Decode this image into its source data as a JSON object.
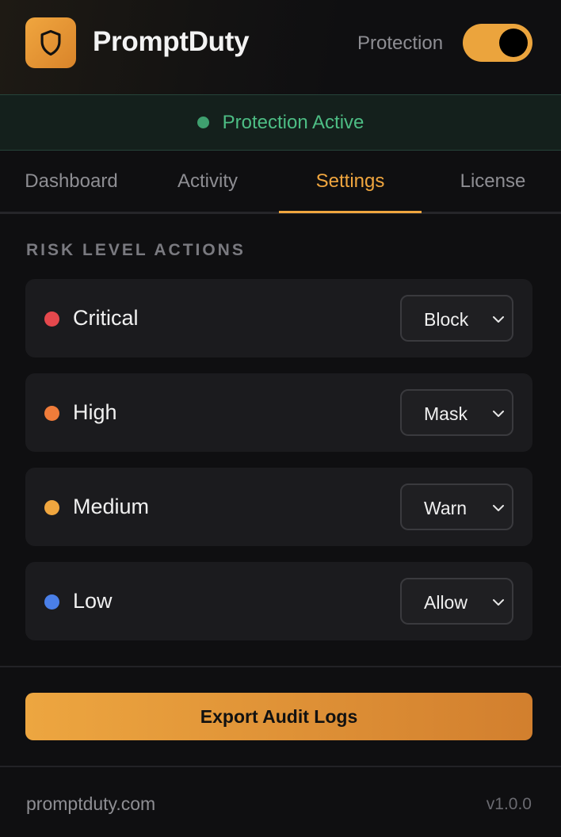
{
  "header": {
    "title": "PromptDuty",
    "logo_icon": "shield-icon",
    "protection_label": "Protection",
    "protection_enabled": true
  },
  "status": {
    "text": "Protection Active",
    "color": "#4dbd84"
  },
  "tabs": [
    {
      "label": "Dashboard",
      "active": false
    },
    {
      "label": "Activity",
      "active": false
    },
    {
      "label": "Settings",
      "active": true
    },
    {
      "label": "License",
      "active": false
    }
  ],
  "risk_section": {
    "title": "RISK LEVEL ACTIONS",
    "levels": [
      {
        "label": "Critical",
        "action": "Block",
        "color": "#e5484d"
      },
      {
        "label": "High",
        "action": "Mask",
        "color": "#f07c3a"
      },
      {
        "label": "Medium",
        "action": "Warn",
        "color": "#f0a63f"
      },
      {
        "label": "Low",
        "action": "Allow",
        "color": "#4a7fe8"
      }
    ]
  },
  "export_button": {
    "label": "Export Audit Logs"
  },
  "footer": {
    "link": "promptduty.com",
    "version": "v1.0.0"
  },
  "colors": {
    "accent": "#f0a63f",
    "background": "#0f0f11"
  }
}
